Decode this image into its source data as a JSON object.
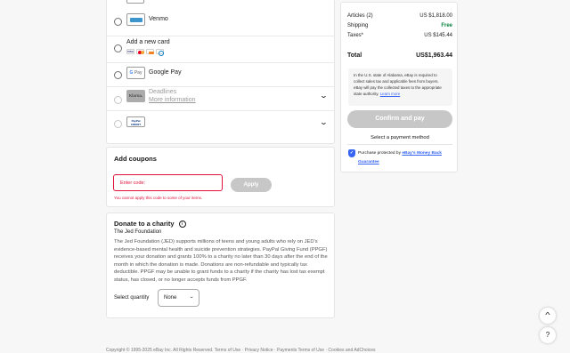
{
  "payment_options": {
    "venmo_label": "Venmo",
    "venmo_logo": "venmo",
    "card_label": "Add a new card",
    "card_brands": [
      {
        "name": "VISA",
        "color": "#1a1f71"
      },
      {
        "name": "MC",
        "color": "#eb001b"
      },
      {
        "name": "DISC",
        "color": "#f58220"
      },
      {
        "name": "DC",
        "color": "#0079be"
      }
    ],
    "gpay_logo": "G Pay",
    "gpay_label": "Google Pay",
    "klarna_logo": "Klarna.",
    "klarna_label": "Deadlines",
    "klarna_link": "More information",
    "paypal_credit_logo": "PayPal Credit"
  },
  "coupons": {
    "title": "Add coupons",
    "input_placeholder": "Enter code:",
    "apply_label": "Apply",
    "error": "You cannot apply this code to some of your items."
  },
  "donate": {
    "title": "Donate to a charity",
    "info_icon": "i",
    "charity": "The Jed Foundation",
    "description": "The Jed Foundation (JED) supports millions of teens and young adults who rely on JED's evidence-based mental health and suicide prevention strategies. PayPal Giving Fund (PPGF) receives your donation and grants 100% to a charity no later than 30 days after the end of the month in which the donation is made. Donations are non-refundable and typically tax deductible. PPGF may be unable to grant funds to a charity if the charity has lost tax exempt status, has closed, or no longer accepts funds from PPGF.",
    "quantity_label": "Select quantity",
    "quantity_value": "None"
  },
  "summary": {
    "articles_label": "Articles (2)",
    "articles_value": "US $1,818.00",
    "shipping_label": "Shipping",
    "shipping_value": "Free",
    "shipping_color": "#05823f",
    "taxes_label": "Taxes*",
    "taxes_value": "US $145.44",
    "total_label": "Total",
    "total_value": "US$1,963.44",
    "notice": "In the U.S. state of Alabama, eBay is required to collect sales tax and applicable fees from buyers. eBay will pay the collected taxes to the appropriate state authority.",
    "notice_link": "Learn more",
    "confirm_label": "Confirm and pay",
    "select_payment": "Select a payment method",
    "protect_text": "Purchase protected by",
    "protect_link": "eBay's Money Back Guarantee"
  },
  "floating": {
    "scroll_top_icon": "chevron-up",
    "help_icon": "?"
  },
  "footer": {
    "text": "Copyright © 1995-2025 eBay Inc. All Rights Reserved. Terms of Use · Privacy Notice · Payments Terms of Use · Cookies and AdChoices"
  }
}
